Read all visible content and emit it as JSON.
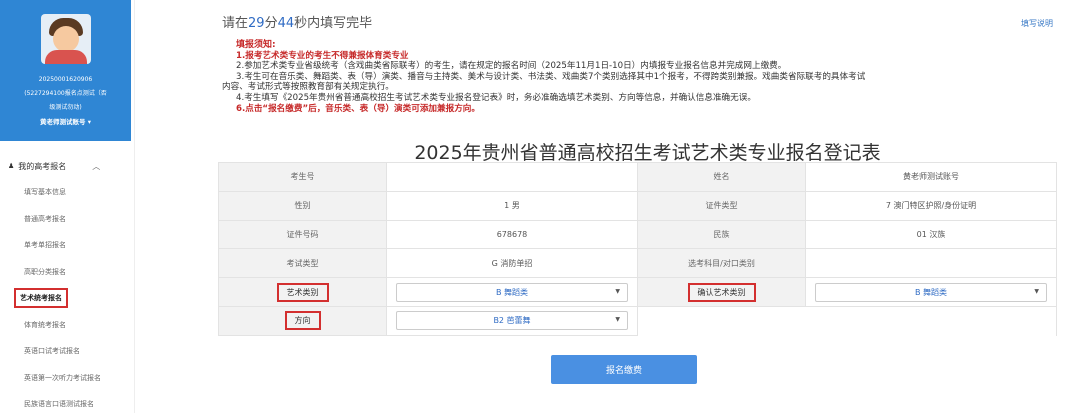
{
  "profile": {
    "id_line": "20250001620906",
    "school_line1": "(5227294100报名点测试（否",
    "school_line2": "级测试勿动)",
    "account": "黄老师测试账号 ▾"
  },
  "sidebar": {
    "section_title": "我的高考报名",
    "items": [
      {
        "label": "填写基本信息"
      },
      {
        "label": "普通高考报名"
      },
      {
        "label": "单考单招报名"
      },
      {
        "label": "高职分类报名"
      },
      {
        "label": "艺术统考报名"
      },
      {
        "label": "体育统考报名"
      },
      {
        "label": "英语口试考试报名"
      },
      {
        "label": "英语第一次听力考试报名"
      },
      {
        "label": "民族语言口语测试报名"
      }
    ]
  },
  "timer": {
    "prefix": "请在",
    "minutes": "29",
    "min_label": "分",
    "seconds": "44",
    "suffix": "秒内填写完毕"
  },
  "help_link": "填写说明",
  "notice": {
    "title": "填报须知:",
    "items": [
      "1.报考艺术类专业的考生不得兼报体育类专业",
      "2.参加艺术类专业省级统考（含戏曲类省际联考）的考生，请在规定的报名时间（2025年11月1日-10日）内填报专业报名信息并完成网上缴费。",
      "3.考生可在音乐类、舞蹈类、表（导）演类、播音与主持类、美术与设计类、书法类、戏曲类7个类别选择其中1个报考，不得跨类别兼报。戏曲类省际联考的具体考试",
      "内容、考试形式等按照教育部有关规定执行。",
      "4.考生填写《2025年贵州省普通高校招生考试艺术类专业报名登记表》时，务必准确选填艺术类别、方向等信息，并确认信息准确无误。",
      "6.点击“报名缴费”后，音乐类、表（导）演类可添加兼报方向。"
    ]
  },
  "form_title": "2025年贵州省普通高校招生考试艺术类专业报名登记表",
  "form": {
    "exam_no_label": "考生号",
    "exam_no": "",
    "name_label": "姓名",
    "name": "黄老师测试账号",
    "gender_label": "性别",
    "gender": "1 男",
    "id_type_label": "证件类型",
    "id_type": "7 澳门特区护照/身份证明",
    "id_no_label": "证件号码",
    "id_no": "678678",
    "ethnic_label": "民族",
    "ethnic": "01 汉族",
    "exam_type_label": "考试类型",
    "exam_type": "G 消防单招",
    "subject_label": "选考科目/对口类别",
    "subject": "",
    "art_label": "艺术类别",
    "art_value": "B 舞蹈类",
    "confirm_art_label": "确认艺术类别",
    "confirm_art_value": "B 舞蹈类",
    "direction_label": "方向",
    "direction_value": "B2 芭蕾舞"
  },
  "submit_label": "报名缴费",
  "colors": {
    "brand_blue": "#2f86d4",
    "button_blue": "#4a90e2",
    "highlight_red": "#d32f2f"
  }
}
